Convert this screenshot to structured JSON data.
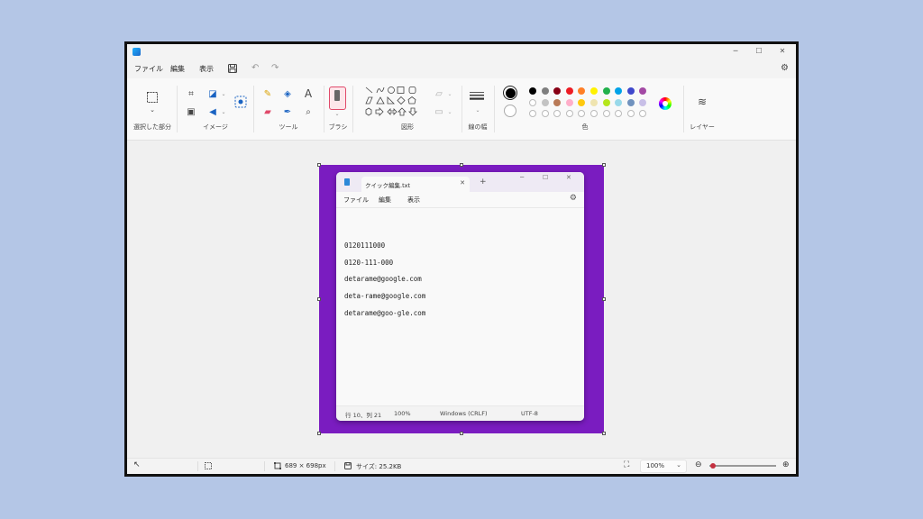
{
  "menu": {
    "file": "ファイル",
    "edit": "編集",
    "view": "表示"
  },
  "ribbon": {
    "selection_label": "選択した部分",
    "image_label": "イメージ",
    "tools_label": "ツール",
    "brush_label": "ブラシ",
    "shapes_label": "図形",
    "stroke_label": "線の幅",
    "colors_label": "色",
    "layers_label": "レイヤー",
    "text_tool_glyph": "A"
  },
  "colors": {
    "primary": "#000000",
    "secondary": "#ffffff",
    "palette_row1": [
      "#000000",
      "#7f7f7f",
      "#880015",
      "#ed1c24",
      "#ff7f27",
      "#fff200",
      "#22b14c",
      "#00a2e8",
      "#3f48cc",
      "#a349a4"
    ],
    "palette_row2": [
      "#ffffff",
      "#c3c3c3",
      "#b97a57",
      "#ffaec9",
      "#ffc90e",
      "#efe4b0",
      "#b5e61d",
      "#99d9ea",
      "#7092be",
      "#c8bfe7"
    ]
  },
  "canvas": {
    "image_bg": "#7a1cc0"
  },
  "notepad": {
    "tab_title": "クイック編集.txt",
    "menu_file": "ファイル",
    "menu_edit": "編集",
    "menu_view": "表示",
    "new_tab": "+",
    "close_tab": "✕",
    "lines": [
      "0120111000",
      "0120-111-000",
      "detarame@google.com",
      "deta-rame@google.com",
      "detarame@goo-gle.com"
    ],
    "status": {
      "position": "行 10、列 21",
      "zoom": "100%",
      "line_ending": "Windows (CRLF)",
      "encoding": "UTF-8"
    }
  },
  "statusbar": {
    "dimensions": "689 × 698px",
    "size": "サイズ: 25.2KB",
    "zoom": "100%"
  },
  "zoom": {
    "level": 0.05
  }
}
